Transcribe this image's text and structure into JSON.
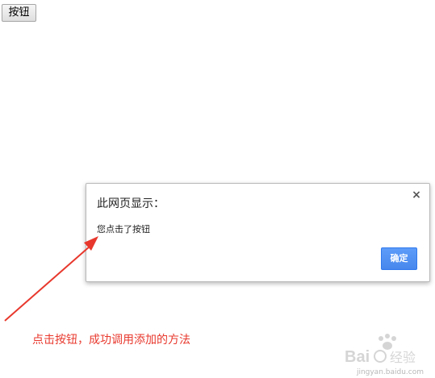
{
  "page": {
    "button_label": "按钮"
  },
  "dialog": {
    "title": "此网页显示：",
    "close_glyph": "×",
    "message": "您点击了按钮",
    "ok_label": "确定"
  },
  "annotation": {
    "text": "点击按钮，成功调用添加的方法",
    "color": "#e8382d"
  },
  "watermark": {
    "text": "Baidu经验",
    "url": "jingyan.baidu.com"
  }
}
